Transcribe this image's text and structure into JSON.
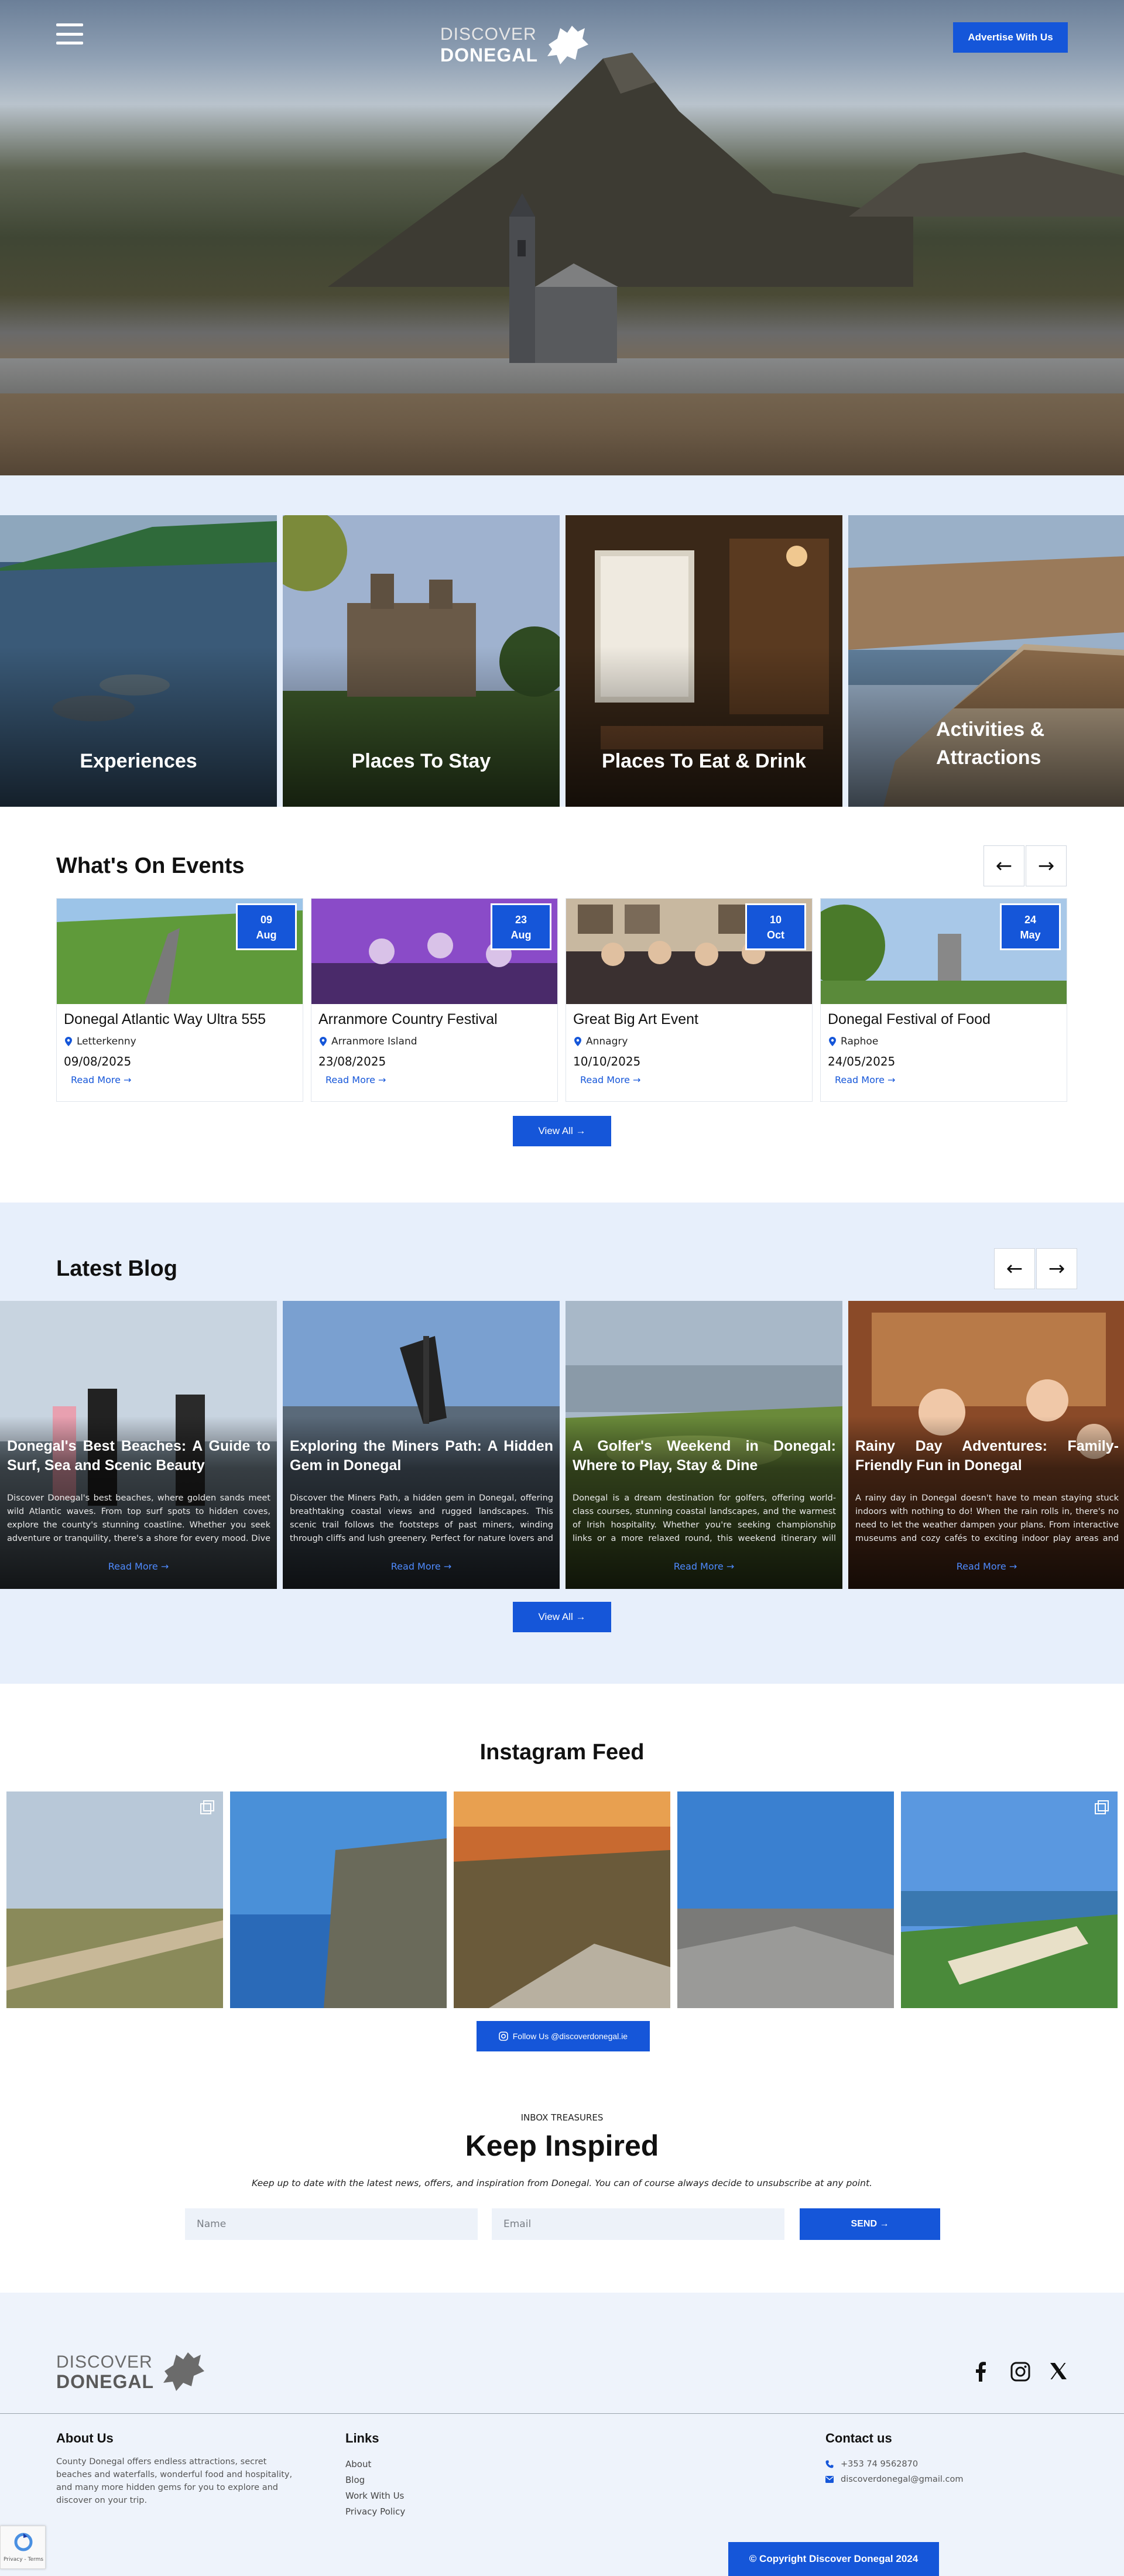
{
  "header": {
    "logo_line1": "DISCOVER",
    "logo_line2": "DONEGAL",
    "advertise_label": "Advertise With Us"
  },
  "categories": [
    {
      "label": "Experiences"
    },
    {
      "label": "Places To Stay"
    },
    {
      "label": "Places To Eat & Drink"
    },
    {
      "label": "Activities & Attractions"
    }
  ],
  "events": {
    "title": "What's On Events",
    "read_more": "Read More",
    "view_all": "View All",
    "items": [
      {
        "day": "09",
        "month": "Aug",
        "title": "Donegal Atlantic Way Ultra 555",
        "location": "Letterkenny",
        "date": "09/08/2025"
      },
      {
        "day": "23",
        "month": "Aug",
        "title": "Arranmore Country Festival",
        "location": "Arranmore Island",
        "date": "23/08/2025"
      },
      {
        "day": "10",
        "month": "Oct",
        "title": "Great Big Art Event",
        "location": "Annagry",
        "date": "10/10/2025"
      },
      {
        "day": "24",
        "month": "May",
        "title": "Donegal Festival of Food",
        "location": "Raphoe",
        "date": "24/05/2025"
      }
    ]
  },
  "blog": {
    "title": "Latest Blog",
    "read_more": "Read More",
    "view_all": "View All",
    "items": [
      {
        "title": "Donegal's Best Beaches: A Guide to Surf, Sea and Scenic Beauty",
        "body": "Discover Donegal's best beaches, where golden sands meet wild Atlantic waves. From top surf spots to hidden coves, explore the county's stunning coastline. Whether you seek adventure or tranquility, there's a shore for every mood. Dive into the beau..."
      },
      {
        "title": "Exploring the Miners Path: A Hidden Gem in Donegal",
        "body": "Discover the Miners Path, a hidden gem in Donegal, offering breathtaking coastal views and rugged landscapes. This scenic trail follows the footsteps of past miners, winding through cliffs and lush greenery. Perfect for nature lovers and adventure seekers,..."
      },
      {
        "title": "A Golfer's Weekend in Donegal: Where to Play, Stay & Dine",
        "body": "Donegal is a dream destination for golfers, offering world-class courses, stunning coastal landscapes, and the warmest of Irish hospitality. Whether you're seeking championship links or a more relaxed round, this weekend itinerary will guide you through t..."
      },
      {
        "title": "Rainy Day Adventures: Family-Friendly Fun in Donegal",
        "body": "A rainy day in Donegal doesn't have to mean staying stuck indoors with nothing to do! When the rain rolls in, there's no need to let the weather dampen your plans. From interactive museums and cozy cafés to exciting indoor play areas and creative worksho..."
      }
    ]
  },
  "instagram": {
    "title": "Instagram Feed",
    "follow_label": "Follow Us @discoverdonegal.ie"
  },
  "newsletter": {
    "eyebrow": "INBOX TREASURES",
    "title": "Keep Inspired",
    "text": "Keep up to date with the latest news, offers, and inspiration from Donegal. You can of course always decide to unsubscribe at any point.",
    "name_placeholder": "Name",
    "email_placeholder": "Email",
    "send_label": "SEND"
  },
  "footer": {
    "logo_line1": "DISCOVER",
    "logo_line2": "DONEGAL",
    "about_title": "About Us",
    "about_text": "County Donegal offers endless attractions, secret beaches and waterfalls, wonderful food and hospitality, and many more hidden gems for you to explore and discover on your trip.",
    "links_title": "Links",
    "links": [
      "About",
      "Blog",
      "Work With Us",
      "Privacy Policy"
    ],
    "contact_title": "Contact us",
    "phone": "+353 74 9562870",
    "email": "discoverdonegal@gmail.com",
    "copyright": "© Copyright Discover Donegal 2024",
    "recaptcha_text": "Privacy - Terms"
  },
  "colors": {
    "accent": "#1556d9",
    "section_bg": "#e7effb",
    "footer_bg": "#eef3fb"
  }
}
